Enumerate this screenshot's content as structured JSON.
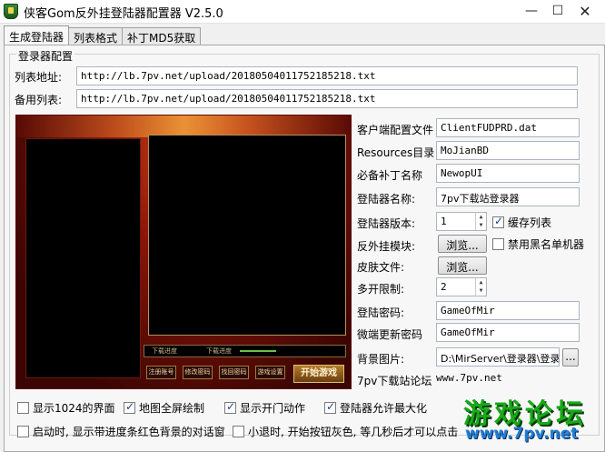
{
  "window": {
    "title": "侠客Gom反外挂登陆器配置器 V2.5.0",
    "min_glyph": "—",
    "max_glyph": "☐",
    "close_glyph": "✕"
  },
  "tabs": [
    {
      "label": "生成登陆器",
      "active": true
    },
    {
      "label": "列表格式",
      "active": false
    },
    {
      "label": "补丁MD5获取",
      "active": false
    }
  ],
  "group": {
    "title": "登录器配置",
    "list_url_label": "列表地址:",
    "list_url_value": "http://lb.7pv.net/upload/20180504011752185218.txt",
    "backup_list_label": "备用列表:",
    "backup_list_value": "http://lb.7pv.net/upload/20180504011752185218.txt"
  },
  "preview": {
    "progress_text": "下载进度",
    "progress_right": "下载进度",
    "buttons": [
      "注册账号",
      "修改密码",
      "找回密码",
      "游戏设置"
    ],
    "start_label": "开始游戏"
  },
  "config": {
    "client_cfg_label": "客户端配置文件",
    "client_cfg_value": "ClientFUDPRD.dat",
    "resources_label": "Resources目录",
    "resources_value": "MoJianBD",
    "patch_label": "必备补丁名称",
    "patch_value": "NewopUI",
    "launcher_name_label": "登陆器名称:",
    "launcher_name_value": "7pv下载站登录器",
    "version_label": "登陆器版本:",
    "version_value": "1",
    "cache_list_label": "缓存列表",
    "cache_list_checked": true,
    "anticheat_label": "反外挂模块:",
    "browse_label": "浏览...",
    "blacklist_label": "禁用黑名单机器",
    "blacklist_checked": false,
    "skin_label": "皮肤文件:",
    "multi_label": "多开限制:",
    "multi_value": "2",
    "password_label": "登陆密码:",
    "password_value": "GameOfMir",
    "micro_pw_label": "微端更新密码",
    "micro_pw_value": "GameOfMir",
    "bg_label": "背景图片:",
    "bg_value": "D:\\MirServer\\登录器\\登录",
    "bg_btn": "...",
    "forum_label": "7pv下载站论坛",
    "forum_value": "www.7pv.net"
  },
  "options": [
    {
      "label": "显示1024的界面",
      "checked": false
    },
    {
      "label": "地图全屏绘制",
      "checked": true
    },
    {
      "label": "显示开门动作",
      "checked": true
    },
    {
      "label": "登陆器允许最大化",
      "checked": true
    },
    {
      "label": "启动时, 显示带进度条红色背景的对话窗",
      "checked": false
    },
    {
      "label": "小退时, 开始按钮灰色, 等几秒后才可以点击",
      "checked": false
    }
  ],
  "watermark": {
    "big": "游戏论坛",
    "url": "www.7pv.net"
  },
  "colors": {
    "check_accent": "#1a3f8a",
    "watermark_green": "#18a818",
    "watermark_blue": "#1f7fd8"
  }
}
